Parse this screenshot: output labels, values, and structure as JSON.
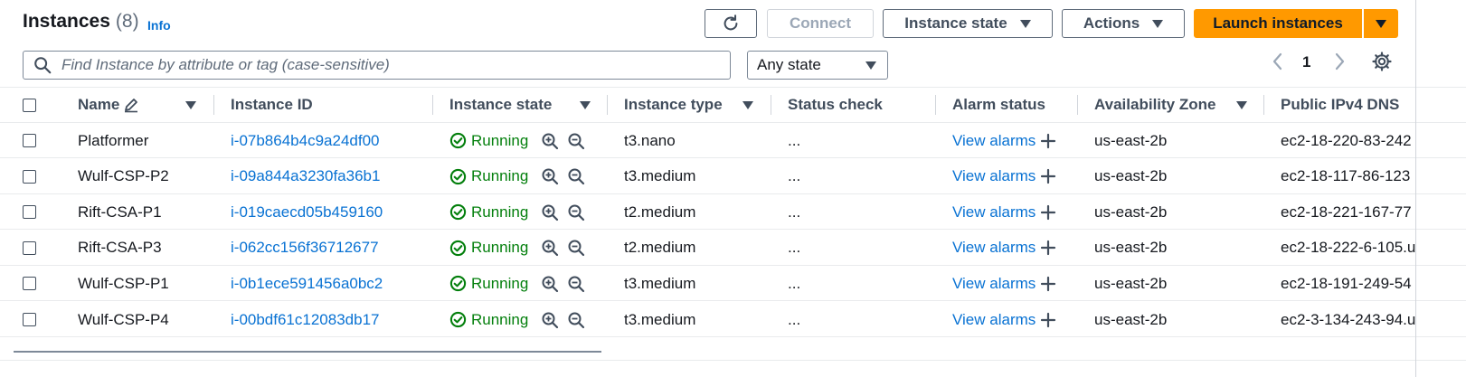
{
  "header": {
    "title": "Instances",
    "count": "(8)",
    "info_label": "Info"
  },
  "toolbar": {
    "refresh_icon": "refresh-icon",
    "connect_label": "Connect",
    "instance_state_label": "Instance state",
    "actions_label": "Actions",
    "launch_label": "Launch instances",
    "colors": {
      "primary": "#ff9900",
      "link": "#0972d3",
      "success": "#037f0c"
    }
  },
  "search": {
    "placeholder": "Find Instance by attribute or tag (case-sensitive)",
    "value": ""
  },
  "state_filter": {
    "value": "Any state"
  },
  "pagination": {
    "current_page": "1"
  },
  "table": {
    "columns": [
      "Name",
      "Instance ID",
      "Instance state",
      "Instance type",
      "Status check",
      "Alarm status",
      "Availability Zone",
      "Public IPv4 DNS"
    ],
    "rows": [
      {
        "name": "Platformer",
        "id": "i-07b864b4c9a24df00",
        "state": "Running",
        "type": "t3.nano",
        "status": "...",
        "alarm": "View alarms",
        "zone": "us-east-2b",
        "dns": "ec2-18-220-83-242"
      },
      {
        "name": "Wulf-CSP-P2",
        "id": "i-09a844a3230fa36b1",
        "state": "Running",
        "type": "t3.medium",
        "status": "...",
        "alarm": "View alarms",
        "zone": "us-east-2b",
        "dns": "ec2-18-117-86-123"
      },
      {
        "name": "Rift-CSA-P1",
        "id": "i-019caecd05b459160",
        "state": "Running",
        "type": "t2.medium",
        "status": "...",
        "alarm": "View alarms",
        "zone": "us-east-2b",
        "dns": "ec2-18-221-167-77"
      },
      {
        "name": "Rift-CSA-P3",
        "id": "i-062cc156f36712677",
        "state": "Running",
        "type": "t2.medium",
        "status": "...",
        "alarm": "View alarms",
        "zone": "us-east-2b",
        "dns": "ec2-18-222-6-105.u"
      },
      {
        "name": "Wulf-CSP-P1",
        "id": "i-0b1ece591456a0bc2",
        "state": "Running",
        "type": "t3.medium",
        "status": "...",
        "alarm": "View alarms",
        "zone": "us-east-2b",
        "dns": "ec2-18-191-249-54"
      },
      {
        "name": "Wulf-CSP-P4",
        "id": "i-00bdf61c12083db17",
        "state": "Running",
        "type": "t3.medium",
        "status": "...",
        "alarm": "View alarms",
        "zone": "us-east-2b",
        "dns": "ec2-3-134-243-94.u"
      }
    ]
  }
}
